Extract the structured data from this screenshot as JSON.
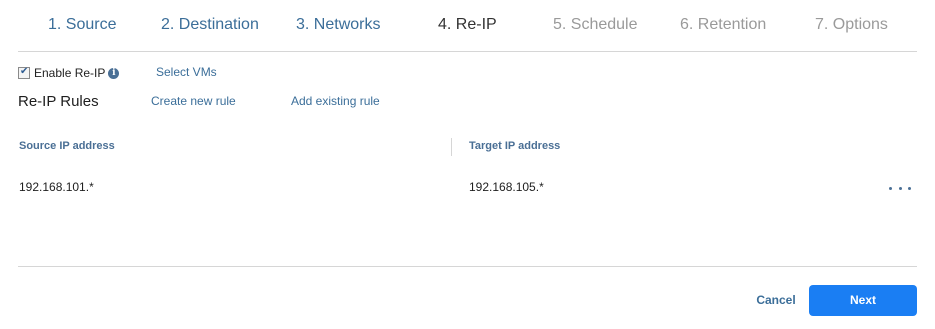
{
  "wizard": {
    "steps": [
      {
        "label": "1. Source",
        "state": "done"
      },
      {
        "label": "2. Destination",
        "state": "done"
      },
      {
        "label": "3. Networks",
        "state": "done"
      },
      {
        "label": "4. Re-IP",
        "state": "current"
      },
      {
        "label": "5. Schedule",
        "state": "future"
      },
      {
        "label": "6. Retention",
        "state": "future"
      },
      {
        "label": "7. Options",
        "state": "future"
      }
    ]
  },
  "reip": {
    "enable_label": "Enable Re-IP",
    "enabled": true,
    "info_icon": "info-icon",
    "select_vms_link": "Select VMs",
    "rules_title": "Re-IP Rules",
    "create_rule_link": "Create new rule",
    "add_existing_link": "Add existing rule"
  },
  "table": {
    "columns": [
      "Source IP address",
      "Target IP address"
    ],
    "rows": [
      {
        "source": "192.168.101.*",
        "target": "192.168.105.*"
      }
    ],
    "row_menu_icon": "more-horizontal-icon"
  },
  "footer": {
    "cancel_label": "Cancel",
    "next_label": "Next"
  },
  "colors": {
    "link": "#3b6e99",
    "primary_button": "#1a7ef3",
    "disabled_step": "#9a9a9a"
  }
}
